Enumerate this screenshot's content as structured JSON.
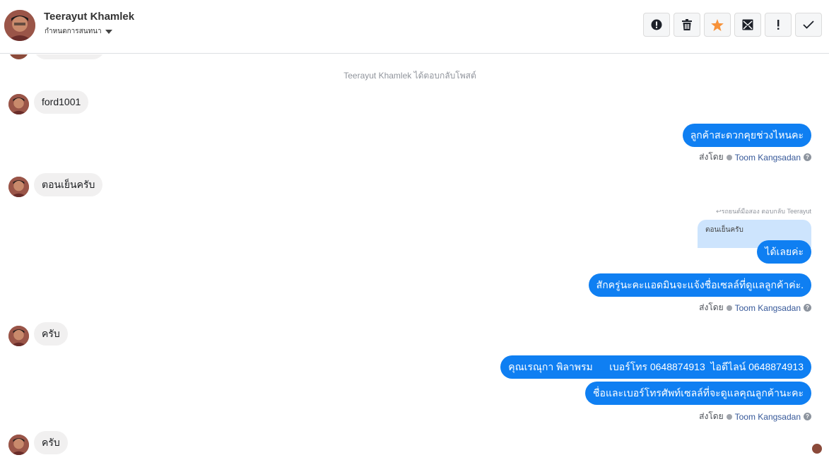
{
  "header": {
    "name": "Teerayut Khamlek",
    "status_label": "กำหนดการสนทนา"
  },
  "toolbar": {
    "buttons": [
      {
        "name": "spam-button",
        "icon": "alert-circle-icon"
      },
      {
        "name": "delete-button",
        "icon": "trash-icon"
      },
      {
        "name": "star-button",
        "icon": "star-icon",
        "color": "#f7923a"
      },
      {
        "name": "archive-button",
        "icon": "envelope-x-icon"
      },
      {
        "name": "follow-up-button",
        "icon": "exclamation-icon"
      },
      {
        "name": "done-button",
        "icon": "checkmark-icon"
      }
    ]
  },
  "thread": {
    "system_notice": "Teerayut Khamlek ได้ตอบกลับโพสต์",
    "msg_ford": "ford1001",
    "msg_agent_1": "ลูกค้าสะดวกคุยช่วงไหนคะ",
    "sent_by_label": "ส่งโดย",
    "agent_name": "Toom Kangsadan",
    "msg_evening": "ตอนเย็นครับ",
    "reply_hint": "รถยนต์มือสอง ตอบกลับ Teerayut",
    "quoted_text": "ตอนเย็นครับ",
    "msg_agent_ok": "ได้เลยค่ะ",
    "msg_agent_wait": "สักครู่นะคะแอดมินจะแจ้งชื่อเซลล์ที่ดูแลลูกค้าค่ะ.",
    "msg_yes_1": "ครับ",
    "msg_agent_contact": "คุณเรณุกา พิลาพรม      เบอร์โทร 0648874913  ไอดีไลน์ 0648874913",
    "msg_agent_intro": "ชื่อและเบอร์โทรศัพท์เซลล์ที่จะดูแลคุณลูกค้านะคะ",
    "msg_yes_2": "ครับ"
  },
  "colors": {
    "outgoing_bubble": "#0f7ff2",
    "incoming_bubble": "#f1f0f0",
    "quote_bubble": "#cde4fd",
    "star": "#f7923a"
  }
}
